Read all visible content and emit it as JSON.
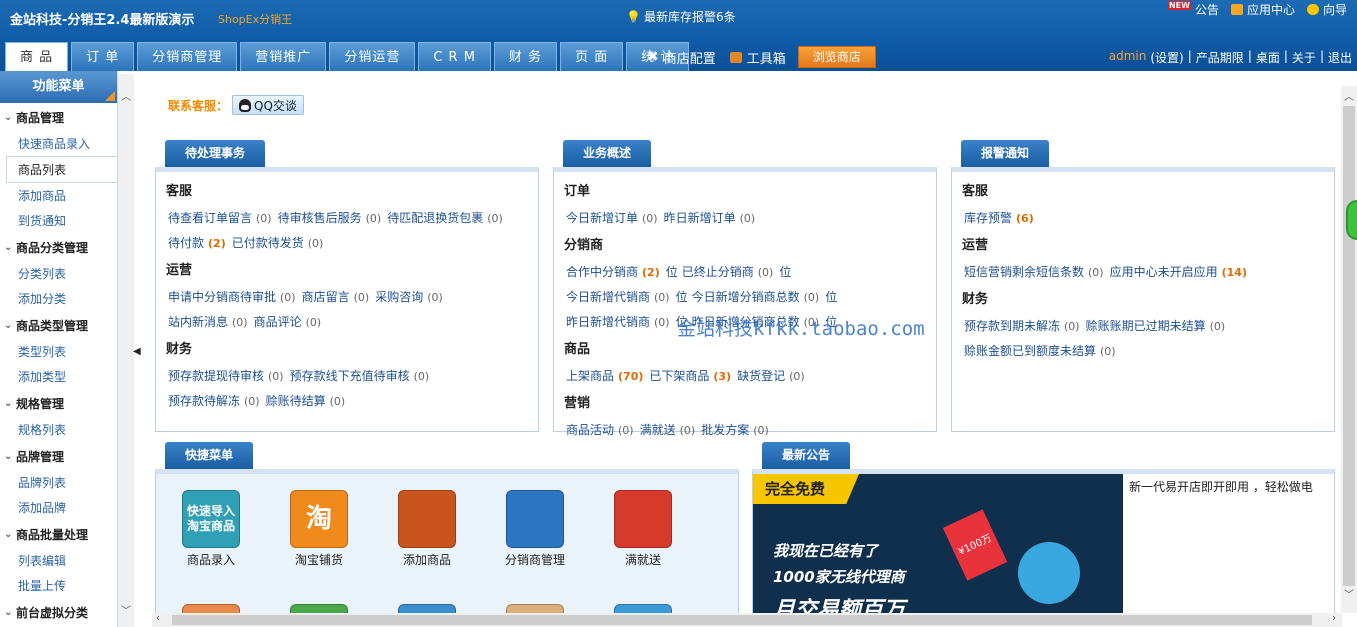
{
  "header": {
    "title": "金站科技-分销王2.4最新版演示",
    "subtitle": "ShopEx分销王",
    "stock_alert": "最新库存报警6条",
    "new_badge": "NEW",
    "links": {
      "notice": "公告",
      "app_center": "应用中心",
      "guide": "向导"
    }
  },
  "tabs": [
    "商 品",
    "订 单",
    "分销商管理",
    "营销推广",
    "分销运营",
    "C R M",
    "财 务",
    "页 面",
    "统 计"
  ],
  "active_tab": 0,
  "tools": {
    "shop_config": "商店配置",
    "toolbox": "工具箱",
    "browse": "浏览商店"
  },
  "user_links": {
    "admin": "admin",
    "settings": "(设置)",
    "sep": "|",
    "period": "产品期限",
    "desktop": "桌面",
    "about": "关于",
    "logout": "退出"
  },
  "sidebar": {
    "header": "功能菜单",
    "groups": [
      {
        "title": "商品管理",
        "items": [
          "快速商品录入",
          "商品列表",
          "添加商品",
          "到货通知"
        ]
      },
      {
        "title": "商品分类管理",
        "items": [
          "分类列表",
          "添加分类"
        ]
      },
      {
        "title": "商品类型管理",
        "items": [
          "类型列表",
          "添加类型"
        ]
      },
      {
        "title": "规格管理",
        "items": [
          "规格列表"
        ]
      },
      {
        "title": "品牌管理",
        "items": [
          "品牌列表",
          "添加品牌"
        ]
      },
      {
        "title": "商品批量处理",
        "items": [
          "列表编辑",
          "批量上传"
        ]
      },
      {
        "title": "前台虚拟分类",
        "items": []
      }
    ],
    "active_item": "商品列表"
  },
  "contact": {
    "label": "联系客服：",
    "qq_button": "QQ交谈"
  },
  "pending": {
    "tab": "待处理事务",
    "sections": {
      "service": "客服",
      "service_rows": [
        [
          [
            "待查看订单留言",
            "(0)"
          ],
          [
            "待审核售后服务",
            "(0)"
          ],
          [
            "待匹配退换货包裹",
            "(0)"
          ]
        ],
        [
          [
            "待付款",
            "(2)"
          ],
          [
            "已付款待发货",
            "(0)"
          ]
        ]
      ],
      "ops": "运营",
      "ops_rows": [
        [
          [
            "申请中分销商待审批",
            "(0)"
          ],
          [
            "商店留言",
            "(0)"
          ],
          [
            "采购咨询",
            "(0)"
          ]
        ],
        [
          [
            "站内新消息",
            "(0)"
          ],
          [
            "商品评论",
            "(0)"
          ]
        ]
      ],
      "finance": "财务",
      "finance_rows": [
        [
          [
            "预存款提现待审核",
            "(0)"
          ],
          [
            "预存款线下充值待审核",
            "(0)"
          ]
        ],
        [
          [
            "预存款待解冻",
            "(0)"
          ],
          [
            "赊账待结算",
            "(0)"
          ]
        ]
      ]
    }
  },
  "overview": {
    "tab": "业务概述",
    "orders": "订单",
    "order_rows": [
      [
        [
          "今日新增订单",
          "(0)"
        ],
        [
          "昨日新增订单",
          "(0)"
        ]
      ]
    ],
    "distributors": "分销商",
    "dist_rows": [
      [
        [
          "合作中分销商",
          "(2)",
          "位"
        ],
        [
          "已终止分销商",
          "(0)",
          "位"
        ]
      ],
      [
        [
          "今日新增代销商",
          "(0)",
          "位"
        ],
        [
          "今日新增分销商总数",
          "(0)",
          "位"
        ]
      ],
      [
        [
          "昨日新增代销商",
          "(0)",
          "位"
        ],
        [
          "昨日新增分销商总数",
          "(0)",
          "位"
        ]
      ]
    ],
    "goods": "商品",
    "goods_rows": [
      [
        [
          "上架商品",
          "(70)"
        ],
        [
          "已下架商品",
          "(3)"
        ],
        [
          "缺货登记",
          "(0)"
        ]
      ]
    ],
    "marketing": "营销",
    "marketing_rows": [
      [
        [
          "商品活动",
          "(0)"
        ],
        [
          "满就送",
          "(0)"
        ],
        [
          "批发方案",
          "(0)"
        ]
      ]
    ]
  },
  "alerts": {
    "tab": "报警通知",
    "service": "客服",
    "service_rows": [
      [
        [
          "库存预警",
          "(6)"
        ]
      ]
    ],
    "ops": "运营",
    "ops_rows": [
      [
        [
          "短信营销剩余短信条数",
          "(0)"
        ],
        [
          "应用中心未开启应用",
          "(14)"
        ]
      ]
    ],
    "finance": "财务",
    "finance_rows": [
      [
        [
          "预存款到期未解冻",
          "(0)"
        ],
        [
          "赊账账期已过期未结算",
          "(0)"
        ]
      ],
      [
        [
          "赊账金额已到额度未结算",
          "(0)"
        ]
      ]
    ]
  },
  "watermark": "金站科技kfkk.taobao.com",
  "quick_menu": {
    "tab": "快捷菜单",
    "items": [
      {
        "label": "商品录入",
        "icon_text": "快速导入 淘宝商品",
        "icon": "taobao-import-icon",
        "color": "#2fa0b5"
      },
      {
        "label": "淘宝铺货",
        "icon_text": "淘",
        "icon": "taobao-icon",
        "color": "#f08a1c"
      },
      {
        "label": "添加商品",
        "icon_text": "",
        "icon": "boxes-icon",
        "color": "#c9541e"
      },
      {
        "label": "分销商管理",
        "icon_text": "",
        "icon": "people-icon",
        "color": "#2a76c2"
      },
      {
        "label": "满就送",
        "icon_text": "",
        "icon": "gift-icon",
        "color": "#d63a2a"
      }
    ]
  },
  "news": {
    "tab": "最新公告",
    "promo_tag": "完全免费",
    "promo_line1": "我现在已经有了",
    "promo_line2": "1000家无线代理商",
    "promo_line3": "月交易额百万",
    "ticket": "¥100万",
    "text": "新一代易开店即开即用 ，轻松做电"
  }
}
